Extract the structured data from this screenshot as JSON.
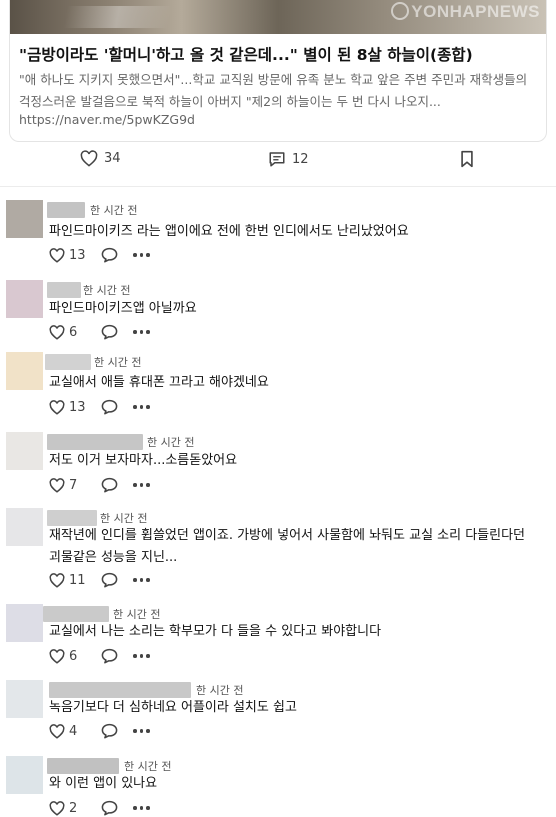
{
  "post": {
    "watermark": "YONHAPNEWS",
    "headline": "\"금방이라도 '할머니'하고 올 것 같은데...\" 별이 된 8살 하늘이(종합)",
    "snippet": "\"애 하나도 지키지 못했으면서\"...학교 교직원 방문에 유족 분노 학교 앞은 주변 주민과 재학생들의 걱정스러운 발걸음으로 북적 하늘이 아버지 \"제2의 하늘이는 두 번 다시 나오지...",
    "link": "https://naver.me/5pwKZG9d",
    "likes": "34",
    "comments": "12"
  },
  "comments": [
    {
      "time": "한 시간 전",
      "text": "파인드마이키즈 라는 앱이에요 전에 한번 인디에서도 난리났었어요",
      "likes": "13",
      "avatar_color": "#b0aaa3",
      "name_color": "#c3c3c3"
    },
    {
      "time": "한 시간 전",
      "text": "파인드마이키즈앱 아닐까요",
      "likes": "6",
      "avatar_color": "#d9c8d0",
      "name_color": "#cbcbcb"
    },
    {
      "time": "한 시간 전",
      "text": "교실애서 애들 휴대폰 끄라고 해야겠네요",
      "likes": "13",
      "avatar_color": "#f1e2c8",
      "name_color": "#d2d2d2"
    },
    {
      "time": "한 시간 전",
      "text": "저도 이거 보자마자...소름돋았어요",
      "likes": "7",
      "avatar_color": "#e9e7e4",
      "name_color": "#c6c6c6"
    },
    {
      "time": "한 시간 전",
      "text": "재작년에 인디를 휩쓸었던 앱이죠. 가방에 넣어서 사물함에 놔둬도 교실 소리 다들린다던 괴물같은 성능을 지닌...",
      "likes": "11",
      "avatar_color": "#e6e6e8",
      "name_color": "#cfcfcf"
    },
    {
      "time": "한 시간 전",
      "text": "교실에서 나는 소리는 학부모가 다 들을 수 있다고 봐야합니다",
      "likes": "6",
      "avatar_color": "#dddde6",
      "name_color": "#cacaca"
    },
    {
      "time": "한 시간 전",
      "text": "녹음기보다 더 심하네요 어플이라 설치도 쉽고",
      "likes": "4",
      "avatar_color": "#e3e7ea",
      "name_color": "#c8c8c8"
    },
    {
      "time": "한 시간 전",
      "text": "와 이런 앱이 있나요",
      "likes": "2",
      "avatar_color": "#dde4e8",
      "name_color": "#c1c1c1"
    }
  ]
}
